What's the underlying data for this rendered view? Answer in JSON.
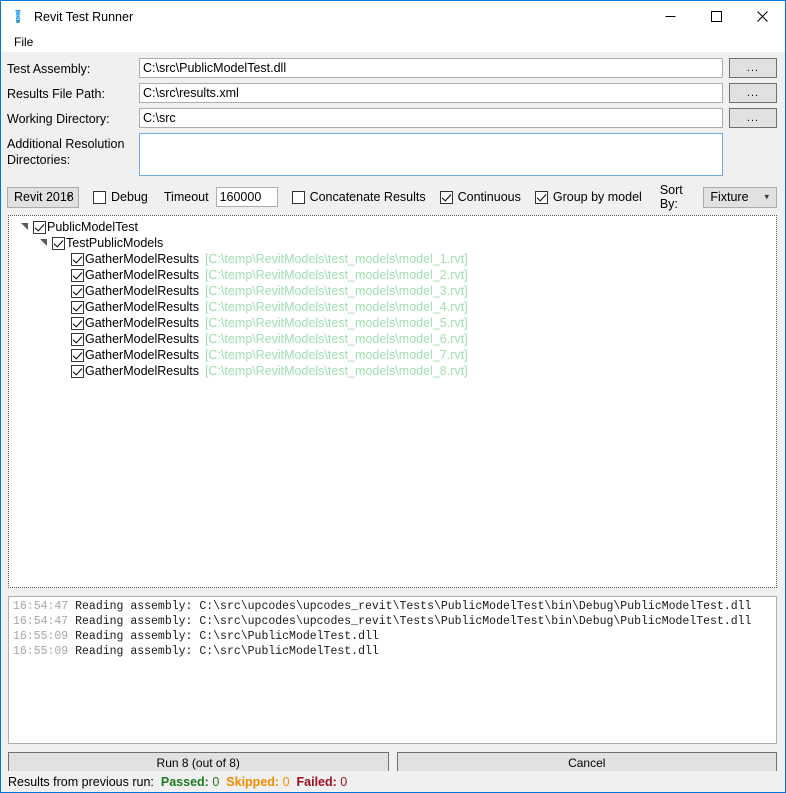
{
  "window": {
    "title": "Revit Test Runner",
    "icon": "test-tube-icon",
    "accent_color": "#0078d7",
    "minimize_label": "Minimize",
    "maximize_label": "Maximize",
    "close_label": "Close"
  },
  "menu": {
    "items": [
      {
        "label": "File"
      }
    ]
  },
  "form": {
    "test_assembly": {
      "label": "Test Assembly:",
      "value": "C:\\src\\PublicModelTest.dll",
      "browse_label": "..."
    },
    "results_file_path": {
      "label": "Results File Path:",
      "value": "C:\\src\\results.xml",
      "browse_label": "..."
    },
    "working_directory": {
      "label": "Working Directory:",
      "value": "C:\\src",
      "browse_label": "..."
    },
    "additional_resolution_directories": {
      "label": "Additional Resolution Directories:",
      "value": "",
      "placeholder": ""
    }
  },
  "options": {
    "revit_version": {
      "selected": "Revit 2018",
      "options": [
        "Revit 2018"
      ]
    },
    "debug": {
      "label": "Debug",
      "checked": false
    },
    "timeout": {
      "label": "Timeout",
      "value": "160000"
    },
    "concatenate_results": {
      "label": "Concatenate Results",
      "checked": false
    },
    "continuous": {
      "label": "Continuous",
      "checked": true
    },
    "group_by_model": {
      "label": "Group by model",
      "checked": true
    },
    "sort_by": {
      "label": "Sort By:",
      "selected": "Fixture",
      "options": [
        "Fixture"
      ]
    }
  },
  "tree": {
    "root": {
      "label": "PublicModelTest",
      "checked": true,
      "expanded": true
    },
    "fixture": {
      "label": "TestPublicModels",
      "checked": true,
      "expanded": true
    },
    "tests": [
      {
        "name": "GatherModelResults",
        "path": "[C:\\temp\\RevitModels\\test_models\\model_1.rvt]",
        "checked": true
      },
      {
        "name": "GatherModelResults",
        "path": "[C:\\temp\\RevitModels\\test_models\\model_2.rvt]",
        "checked": true
      },
      {
        "name": "GatherModelResults",
        "path": "[C:\\temp\\RevitModels\\test_models\\model_3.rvt]",
        "checked": true
      },
      {
        "name": "GatherModelResults",
        "path": "[C:\\temp\\RevitModels\\test_models\\model_4.rvt]",
        "checked": true
      },
      {
        "name": "GatherModelResults",
        "path": "[C:\\temp\\RevitModels\\test_models\\model_5.rvt]",
        "checked": true
      },
      {
        "name": "GatherModelResults",
        "path": "[C:\\temp\\RevitModels\\test_models\\model_6.rvt]",
        "checked": true
      },
      {
        "name": "GatherModelResults",
        "path": "[C:\\temp\\RevitModels\\test_models\\model_7.rvt]",
        "checked": true
      },
      {
        "name": "GatherModelResults",
        "path": "[C:\\temp\\RevitModels\\test_models\\model_8.rvt]",
        "checked": true
      }
    ],
    "path_color": "#9fdfaf"
  },
  "log": {
    "lines": [
      {
        "time": "16:54:47",
        "message": "Reading assembly: C:\\src\\upcodes\\upcodes_revit\\Tests\\PublicModelTest\\bin\\Debug\\PublicModelTest.dll"
      },
      {
        "time": "16:54:47",
        "message": "Reading assembly: C:\\src\\upcodes\\upcodes_revit\\Tests\\PublicModelTest\\bin\\Debug\\PublicModelTest.dll"
      },
      {
        "time": "16:55:09",
        "message": "Reading assembly: C:\\src\\PublicModelTest.dll"
      },
      {
        "time": "16:55:09",
        "message": "Reading assembly: C:\\src\\PublicModelTest.dll"
      }
    ]
  },
  "actions": {
    "run_label": "Run 8 (out of 8)",
    "cancel_label": "Cancel"
  },
  "status": {
    "lead": "Results from previous run:",
    "passed_label": "Passed:",
    "passed_value": "0",
    "passed_color": "#1f7a1f",
    "skipped_label": "Skipped:",
    "skipped_value": "0",
    "skipped_color": "#f08c00",
    "failed_label": "Failed:",
    "failed_value": "0",
    "failed_color": "#a01020"
  }
}
